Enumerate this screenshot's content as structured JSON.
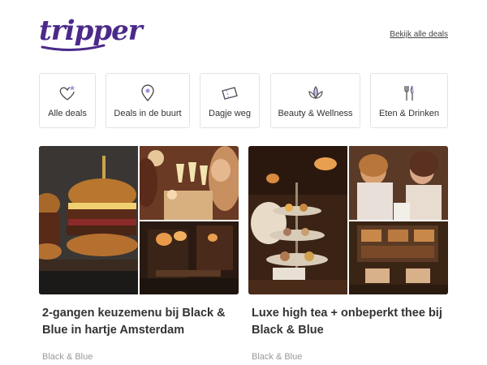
{
  "header": {
    "logo_text": "tripper",
    "all_deals_link": "Bekijk alle deals",
    "brand_color": "#4b2a8a"
  },
  "categories": [
    {
      "label": "Alle deals",
      "icon": "heart-star-icon"
    },
    {
      "label": "Deals in de buurt",
      "icon": "location-pin-icon"
    },
    {
      "label": "Dagje weg",
      "icon": "ticket-icon"
    },
    {
      "label": "Beauty & Wellness",
      "icon": "lotus-icon"
    },
    {
      "label": "Eten & Drinken",
      "icon": "fork-knife-icon"
    }
  ],
  "deals": [
    {
      "title": "2-gangen keuzemenu bij Black & Blue in hartje Amsterdam",
      "vendor": "Black & Blue",
      "images": [
        "burger-photo",
        "champagne-toast-photo",
        "restaurant-interior-photo"
      ]
    },
    {
      "title": "Luxe high tea + onbeperkt thee bij Black & Blue",
      "vendor": "Black & Blue",
      "images": [
        "high-tea-stand-photo",
        "friends-drinking-tea-photo",
        "lounge-interior-photo"
      ]
    }
  ]
}
